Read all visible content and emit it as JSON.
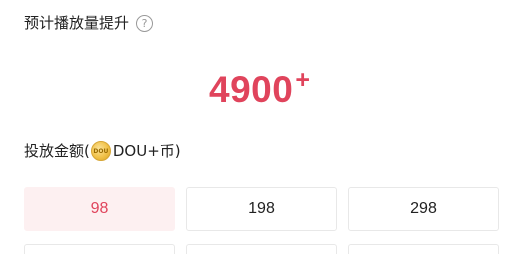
{
  "estimate": {
    "label": "预计播放量提升",
    "help_icon": "?",
    "value": "4900",
    "suffix": "+"
  },
  "amount": {
    "label_prefix": "投放金额(",
    "currency": "DOU+币",
    "label_suffix": ")",
    "coin_icon": "dou-coin-icon",
    "options": [
      {
        "label": "98",
        "selected": true
      },
      {
        "label": "198",
        "selected": false
      },
      {
        "label": "298",
        "selected": false
      }
    ]
  },
  "colors": {
    "accent": "#e0445c",
    "selected_bg": "#fdf0f1",
    "border": "#e8e8e8"
  }
}
